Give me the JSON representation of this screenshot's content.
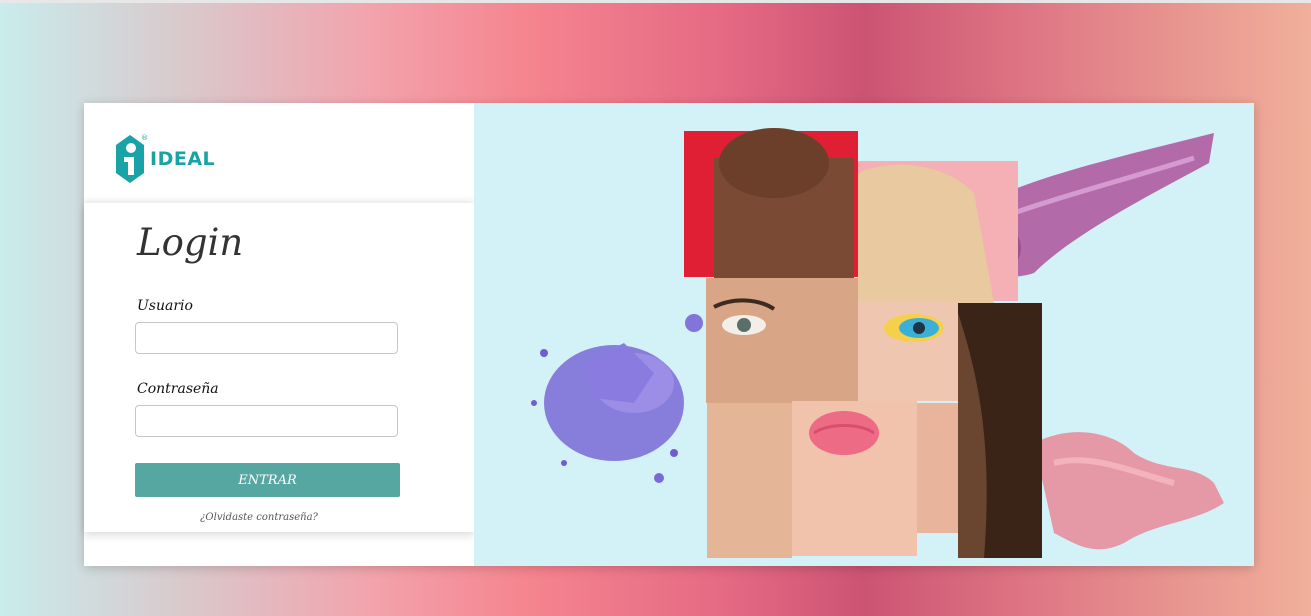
{
  "brand": {
    "logo_text": "IDEAL",
    "registered_mark": "®",
    "color": "#1aa3a6"
  },
  "login": {
    "title": "Login",
    "username_label": "Usuario",
    "username_value": "",
    "password_label": "Contraseña",
    "password_value": "",
    "submit_label": "ENTRAR",
    "forgot_label": "¿Olvidaste contraseña?",
    "button_color": "#56a6a2"
  },
  "hero": {
    "background_color": "#d2f2f8"
  }
}
